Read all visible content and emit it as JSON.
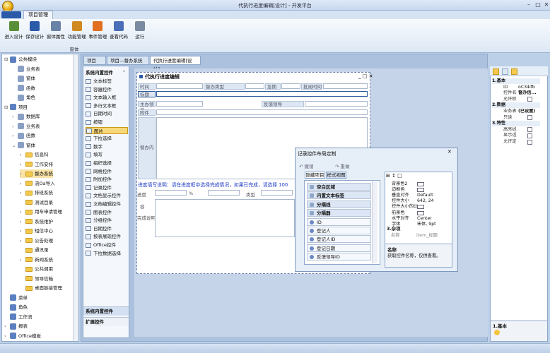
{
  "app": {
    "title": "代执行进度编辑[设计] - 开发平台",
    "ribbon_tab": "项目管理",
    "group_label": "窗体"
  },
  "ribbon_buttons": [
    "进入设计",
    "保存设计",
    "窗体属性",
    "功能管理",
    "事件管理",
    "查看代码",
    "运行"
  ],
  "tree": [
    {
      "label": "公共模块",
      "depth": 0,
      "exp": "⊟"
    },
    {
      "label": "业务表",
      "depth": 1,
      "exp": ""
    },
    {
      "label": "窗体",
      "depth": 1,
      "exp": ""
    },
    {
      "label": "函数",
      "depth": 1,
      "exp": ""
    },
    {
      "label": "角色",
      "depth": 1,
      "exp": ""
    },
    {
      "label": "项目",
      "depth": 0,
      "exp": "⊟"
    },
    {
      "label": "数据库",
      "depth": 1,
      "exp": "›"
    },
    {
      "label": "业务表",
      "depth": 1,
      "exp": "›"
    },
    {
      "label": "函数",
      "depth": 1,
      "exp": "›"
    },
    {
      "label": "窗体",
      "depth": 1,
      "exp": "⌄"
    },
    {
      "label": "信息科",
      "depth": 2,
      "exp": "›"
    },
    {
      "label": "工作安排",
      "depth": 2,
      "exp": "›"
    },
    {
      "label": "督办系统",
      "depth": 2,
      "exp": "›"
    },
    {
      "label": "流Oa导入",
      "depth": 2,
      "exp": "›"
    },
    {
      "label": "排班系统",
      "depth": 2,
      "exp": "›"
    },
    {
      "label": "测试目录",
      "depth": 2,
      "exp": ""
    },
    {
      "label": "用车申请管理",
      "depth": 2,
      "exp": "›"
    },
    {
      "label": "系统维护",
      "depth": 2,
      "exp": "›"
    },
    {
      "label": "短信中心",
      "depth": 2,
      "exp": "›"
    },
    {
      "label": "公告处理",
      "depth": 2,
      "exp": "›"
    },
    {
      "label": "通讯录",
      "depth": 2,
      "exp": ""
    },
    {
      "label": "新闻系统",
      "depth": 2,
      "exp": "›"
    },
    {
      "label": "公共调用",
      "depth": 2,
      "exp": ""
    },
    {
      "label": "领导信箱",
      "depth": 2,
      "exp": ""
    },
    {
      "label": "桌面链接管理",
      "depth": 2,
      "exp": ""
    },
    {
      "label": "菜单",
      "depth": 0,
      "exp": ""
    },
    {
      "label": "角色",
      "depth": 0,
      "exp": ""
    },
    {
      "label": "工作流",
      "depth": 0,
      "exp": ""
    },
    {
      "label": "报表",
      "depth": 0,
      "exp": "›"
    },
    {
      "label": "Office模板",
      "depth": 0,
      "exp": "›"
    }
  ],
  "doc_tabs": [
    "项目",
    "项目—督办系统",
    "代执行进度编辑[设计]"
  ],
  "toolbox": {
    "header": "系统内置控件",
    "items": [
      "文本标签",
      "容器控件",
      "文本输入框",
      "多行文本框",
      "日期时间",
      "按钮",
      "图片",
      "下拉选择",
      "数字",
      "填写",
      "组织选择",
      "网格控件",
      "附加控件",
      "记录控件",
      "文档显示控件",
      "文档编辑控件",
      "图表控件",
      "分组控件",
      "日期控件",
      "按表展现控件",
      "Office控件",
      "下拉数据选择"
    ],
    "selected": "图片",
    "footer_sections": [
      "系统内置控件",
      "扩展控件"
    ]
  },
  "form": {
    "title": "代执行进度编辑",
    "labels": [
      "时间",
      "督办类型",
      "急期",
      "批阅时间",
      "标题",
      "主办领导",
      "反馈领导",
      "附件",
      "督办内容"
    ],
    "instruction": "进度填写说明：请在进度框中选择完成情况，如果已完成，请选择 100",
    "row_progress": "进度",
    "unit": "%",
    "type_label": "类型",
    "desc_label": "完成说明"
  },
  "dialog": {
    "title": "记录控件布局定制",
    "undo": "撤销",
    "redo": "重做",
    "tabs": [
      "隐藏项目",
      "样式视图"
    ],
    "fields": [
      "空白区域",
      "内置文本标签",
      "分隔线",
      "分隔器",
      "ID",
      "登记人",
      "登记人ID",
      "登记日期",
      "反馈领导ID"
    ],
    "props": [
      [
        "背景色2",
        ""
      ],
      [
        "边框色",
        ""
      ],
      [
        "垂直对齐",
        "Default"
      ],
      [
        "控件大小",
        "642, 24"
      ],
      [
        "控件大小的比",
        ""
      ],
      [
        "前景色",
        ""
      ],
      [
        "水平对齐",
        "Center"
      ],
      [
        "字体",
        "宋体, 9pt"
      ]
    ],
    "category": "3.杂项",
    "name_label": "名称",
    "name_value": "item_标题",
    "desc_title": "名称",
    "desc_text": "获取控件名称，仅供查看。"
  },
  "right_panel": {
    "sections": [
      {
        "title": "1.基本",
        "rows": [
          [
            "ID",
            "oC34ifb"
          ],
          [
            "控件名",
            "督办信..."
          ],
          [
            "允许权",
            ""
          ]
        ]
      },
      {
        "title": "2.数据",
        "rows": [
          [
            "业务表",
            "(已设置)"
          ],
          [
            "只读",
            ""
          ]
        ]
      },
      {
        "title": "3.特性",
        "rows": [
          [
            "高亮线",
            ""
          ],
          [
            "显示适",
            ""
          ],
          [
            "允许定",
            ""
          ]
        ]
      }
    ],
    "footer_title": "1.基本"
  }
}
